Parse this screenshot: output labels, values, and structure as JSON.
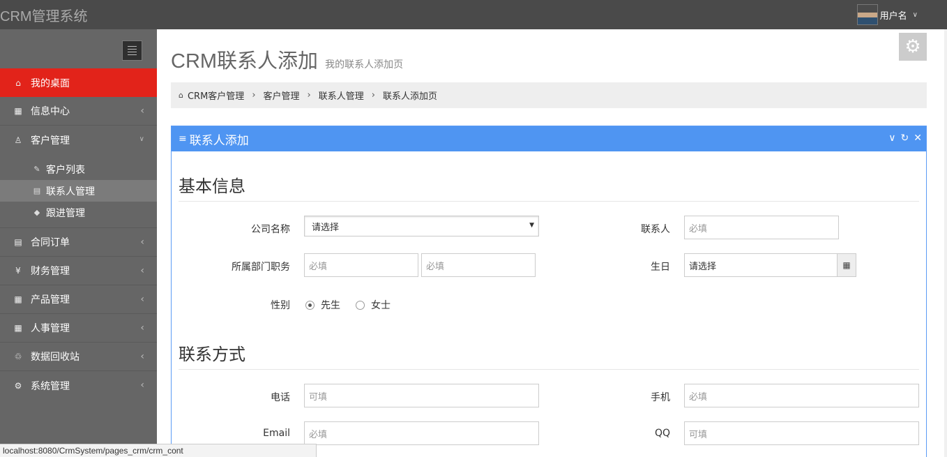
{
  "app": {
    "title": "CRM管理系统"
  },
  "user": {
    "name": "用户名",
    "avatar_icon": "user-avatar",
    "caret_icon": "chevron-down-icon"
  },
  "sidebar": {
    "items": [
      {
        "label": "我的桌面",
        "icon": "home-icon",
        "active": true
      },
      {
        "label": "信息中心",
        "icon": "calendar-icon"
      },
      {
        "label": "客户管理",
        "icon": "user-icon",
        "expanded": true,
        "children": [
          {
            "label": "客户列表",
            "icon": "edit-icon"
          },
          {
            "label": "联系人管理",
            "icon": "book-icon",
            "current": true
          },
          {
            "label": "跟进管理",
            "icon": "tag-icon"
          }
        ]
      },
      {
        "label": "合同订单",
        "icon": "book-icon"
      },
      {
        "label": "财务管理",
        "icon": "yen-icon"
      },
      {
        "label": "产品管理",
        "icon": "table-icon"
      },
      {
        "label": "人事管理",
        "icon": "table-icon"
      },
      {
        "label": "数据回收站",
        "icon": "trash-icon"
      },
      {
        "label": "系统管理",
        "icon": "gear-icon"
      }
    ]
  },
  "page": {
    "title": "CRM联系人添加",
    "subtitle": "我的联系人添加页"
  },
  "breadcrumb": [
    "CRM客户管理",
    "客户管理",
    "联系人管理",
    "联系人添加页"
  ],
  "panel": {
    "title": "联系人添加"
  },
  "form": {
    "basic_title": "基本信息",
    "company_label": "公司名称",
    "company_value": "请选择",
    "contact_label": "联系人",
    "contact_placeholder": "必填",
    "dept_label": "所属部门职务",
    "dept_placeholder": "必填",
    "position_placeholder": "必填",
    "birthday_label": "生日",
    "birthday_value": "请选择",
    "gender_label": "性别",
    "gender_options": [
      "先生",
      "女士"
    ],
    "gender_selected": "先生",
    "contact_title": "联系方式",
    "phone_label": "电话",
    "phone_placeholder": "可填",
    "mobile_label": "手机",
    "mobile_placeholder": "必填",
    "email_label": "Email",
    "email_placeholder": "必填",
    "qq_label": "QQ",
    "qq_placeholder": "可填"
  },
  "status_bar": {
    "url": "localhost:8080/CrmSystem/pages_crm/crm_cont"
  }
}
